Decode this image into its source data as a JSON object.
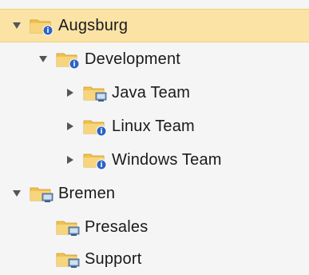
{
  "tree": {
    "nodes": [
      {
        "label": "Augsburg",
        "level": 0,
        "expander": "expanded",
        "icon": "folder-info-icon",
        "selected": true
      },
      {
        "label": "Development",
        "level": 1,
        "expander": "expanded",
        "icon": "folder-info-icon",
        "selected": false
      },
      {
        "label": "Java Team",
        "level": 2,
        "expander": "collapsed",
        "icon": "folder-computer-icon",
        "selected": false
      },
      {
        "label": "Linux Team",
        "level": 2,
        "expander": "collapsed",
        "icon": "folder-info-icon",
        "selected": false
      },
      {
        "label": "Windows Team",
        "level": 2,
        "expander": "collapsed",
        "icon": "folder-info-icon",
        "selected": false
      },
      {
        "label": "Bremen",
        "level": 0,
        "expander": "expanded",
        "icon": "folder-computer-icon",
        "selected": false
      },
      {
        "label": "Presales",
        "level": 1,
        "expander": "none",
        "icon": "folder-computer-icon",
        "selected": false
      },
      {
        "label": "Support",
        "level": 1,
        "expander": "none",
        "icon": "folder-computer-icon",
        "selected": false
      }
    ]
  },
  "colors": {
    "selection_bg": "#fbe3a6",
    "selection_border": "#f1cf79",
    "folder": "#f2c14e",
    "info_badge": "#2b63c6",
    "computer_badge": "#6e8fb5",
    "expander": "#555555"
  }
}
